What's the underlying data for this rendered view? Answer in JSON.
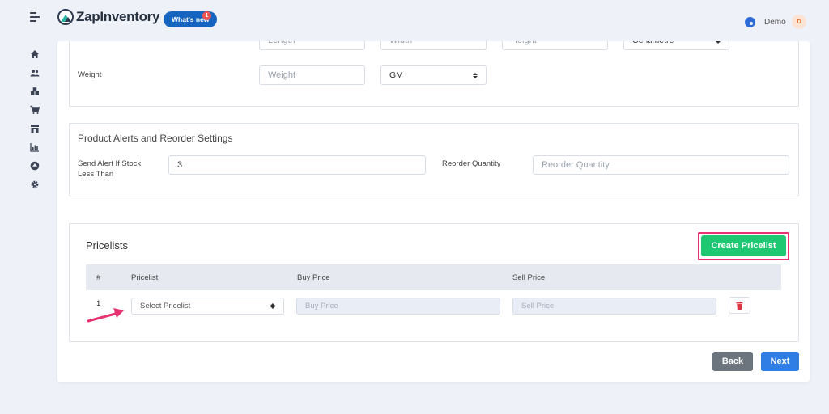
{
  "app": {
    "brand": "ZapInventory",
    "whats_new": "What's new",
    "whats_new_count": "1",
    "user_name": "Demo",
    "user_initial": "D"
  },
  "dimensions": {
    "length_placeholder": "Length",
    "width_placeholder": "Width",
    "height_placeholder": "Height",
    "unit_value": "Centimetre",
    "weight_label": "Weight",
    "weight_placeholder": "Weight",
    "weight_unit": "GM"
  },
  "alerts": {
    "title": "Product Alerts and Reorder Settings",
    "stock_alert_label": "Send Alert If Stock Less Than",
    "stock_alert_value": "3",
    "reorder_label": "Reorder Quantity",
    "reorder_placeholder": "Reorder Quantity"
  },
  "pricelists": {
    "title": "Pricelists",
    "create_button": "Create Pricelist",
    "columns": [
      "#",
      "Pricelist",
      "Buy Price",
      "Sell Price"
    ],
    "rows": [
      {
        "num": "1",
        "pricelist_value": "Select Pricelist",
        "buy_placeholder": "Buy Price",
        "sell_placeholder": "Sell Price"
      }
    ]
  },
  "footer": {
    "back": "Back",
    "next": "Next"
  },
  "colors": {
    "accent_green": "#1ec872",
    "highlight": "#e6336f",
    "primary_blue": "#2f7ee6",
    "back_gray": "#6c757d"
  },
  "icons": [
    "menu-icon",
    "home-icon",
    "users-icon",
    "boxes-icon",
    "cart-icon",
    "store-icon",
    "chart-icon",
    "upload-icon",
    "gear-icon",
    "trash-icon",
    "palette-icon"
  ]
}
